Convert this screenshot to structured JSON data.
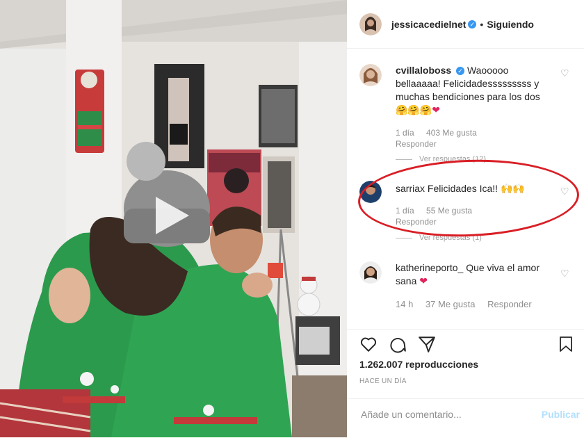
{
  "post": {
    "username": "jessicacedielnet",
    "follow_status": "Siguiendo",
    "separator": "•"
  },
  "comments": [
    {
      "username": "cvillaloboss",
      "verified": true,
      "text": "Waooooo bellaaaaa! Felicidadesssssssss y muchas bendiciones para los dos",
      "emojis": "🤗🤗🤗",
      "heart": "❤",
      "age": "1 día",
      "likes": "403 Me gusta",
      "reply_label": "Responder",
      "view_replies": "Ver respuestas (12)"
    },
    {
      "username": "sarriax",
      "verified": false,
      "text": "Felicidades Ica!!",
      "emojis": "🙌🙌",
      "age": "1 día",
      "likes": "55 Me gusta",
      "reply_label": "Responder",
      "view_replies": "Ver respuestas (1)"
    },
    {
      "username": "katherineporto_",
      "verified": false,
      "text": "Que viva el amor sana",
      "heart": "❤",
      "age": "14 h",
      "likes": "37 Me gusta",
      "reply_label": "Responder"
    }
  ],
  "stats": {
    "views": "1.262.007 reproducciones",
    "posted": "HACE UN DÍA"
  },
  "comment_box": {
    "placeholder": "Añade un comentario...",
    "publish_label": "Publicar"
  },
  "icons": {
    "play": "play-icon",
    "like": "heart-icon",
    "comment": "comment-icon",
    "share": "share-icon",
    "save": "bookmark-icon",
    "verified": "verified-badge-icon"
  },
  "colors": {
    "accent": "#3897f0",
    "muted": "#8e8e8e",
    "highlight": "#d91f26",
    "sweater_green": "#2a9a4a"
  }
}
